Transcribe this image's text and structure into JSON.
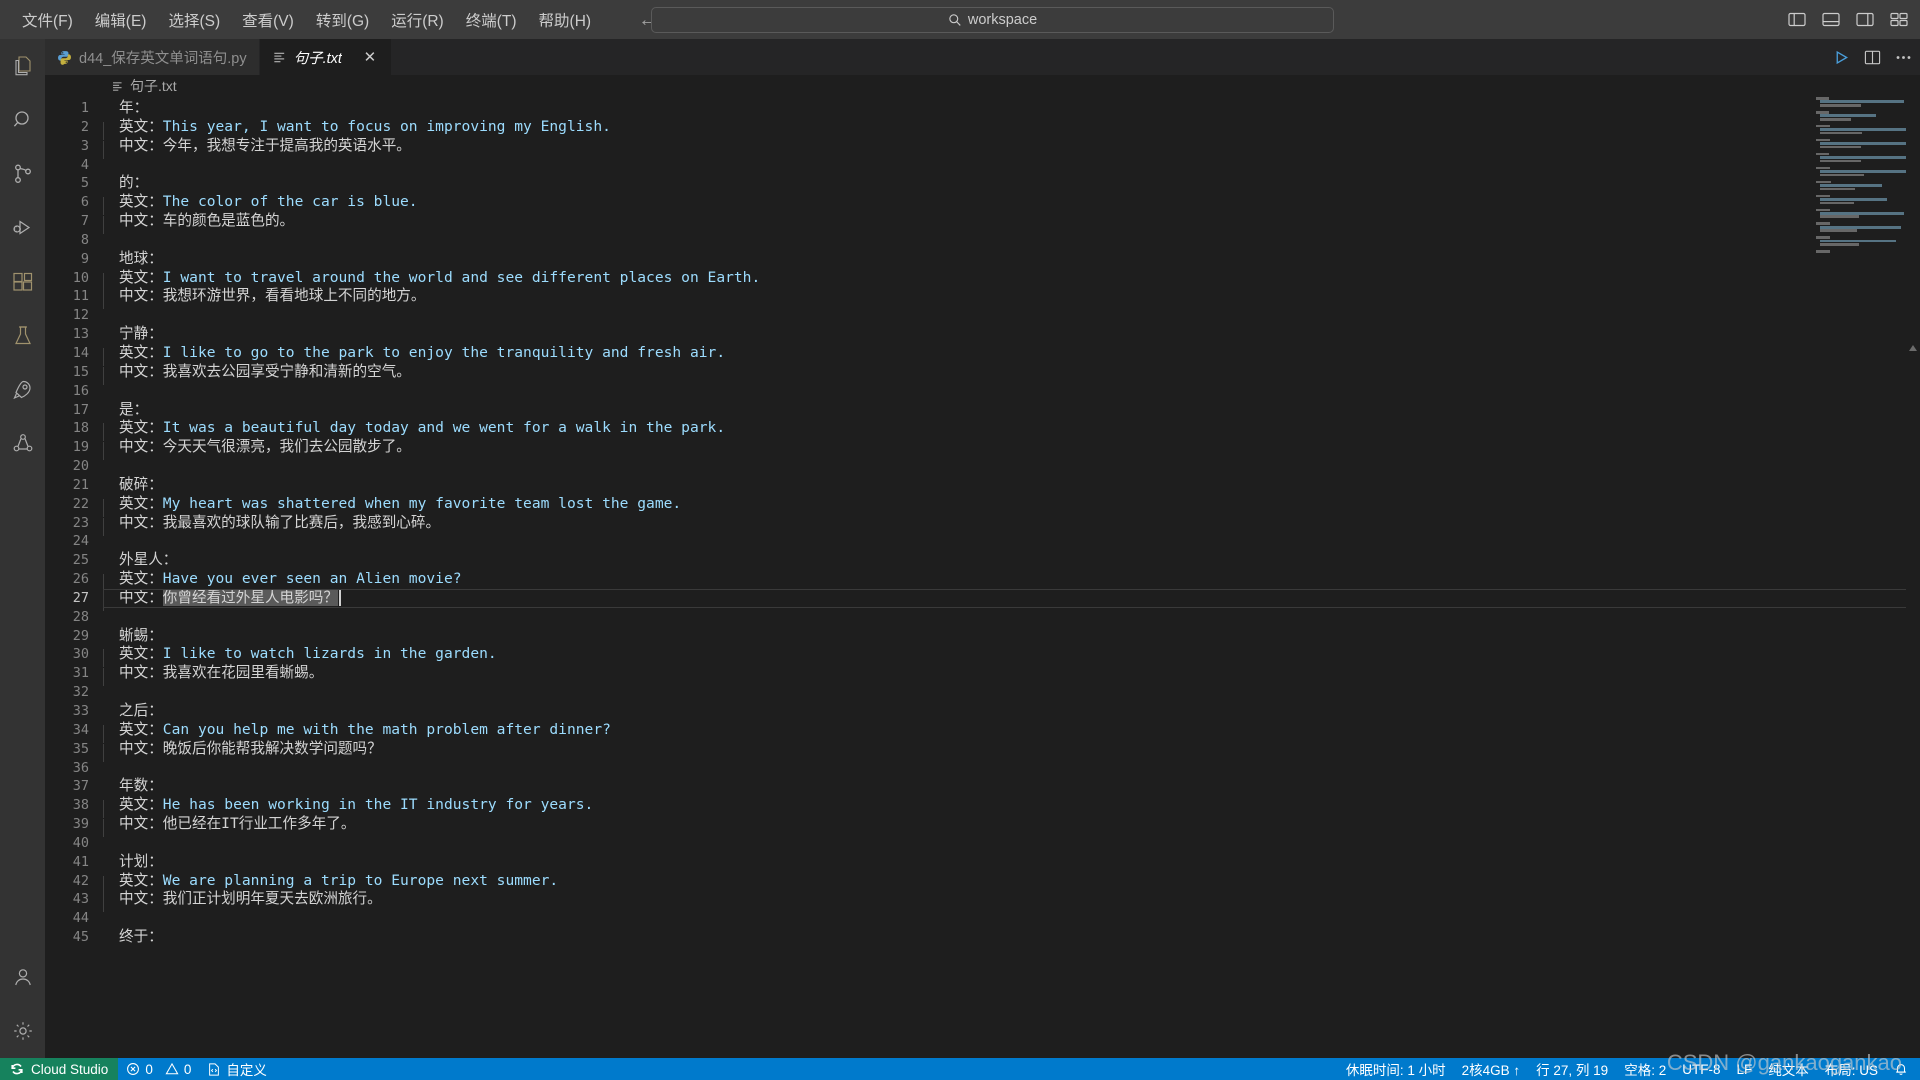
{
  "titlebar": {
    "menus": [
      "文件(F)",
      "编辑(E)",
      "选择(S)",
      "查看(V)",
      "转到(G)",
      "运行(R)",
      "终端(T)",
      "帮助(H)"
    ],
    "back_arrow": "←",
    "forward_arrow": "→",
    "search_value": "workspace",
    "icons": {
      "search": "search-icon",
      "panel_left": "toggle-primary-sidebar-icon",
      "panel_bottom": "toggle-panel-icon",
      "panel_right": "toggle-secondary-sidebar-icon",
      "layout": "customize-layout-icon"
    }
  },
  "activitybar": {
    "items": [
      {
        "name": "explorer",
        "icon": "files-icon"
      },
      {
        "name": "search",
        "icon": "search-icon"
      },
      {
        "name": "source-control",
        "icon": "source-control-icon"
      },
      {
        "name": "run-and-debug",
        "icon": "run-debug-icon"
      },
      {
        "name": "extensions",
        "icon": "extensions-icon"
      },
      {
        "name": "testing",
        "icon": "beaker-icon"
      },
      {
        "name": "remote-explorer",
        "icon": "rocket-icon"
      },
      {
        "name": "collaboration",
        "icon": "collaboration-icon"
      }
    ],
    "bottom": [
      {
        "name": "accounts",
        "icon": "account-icon"
      },
      {
        "name": "settings",
        "icon": "gear-icon"
      }
    ]
  },
  "tabs": [
    {
      "label": "d44_保存英文单词语句.py",
      "icon": "python-icon",
      "active": false,
      "italic": false
    },
    {
      "label": "句子.txt",
      "icon": "text-file-icon",
      "active": true,
      "italic": true,
      "close": "✕"
    }
  ],
  "tab_actions": {
    "run": "run-file-icon",
    "split": "split-editor-icon",
    "more": "more-actions-icon"
  },
  "breadcrumb": {
    "icon": "text-file-icon",
    "label": "句子.txt"
  },
  "editor": {
    "cursor_line": 27,
    "selection_text": "你曾经看过外星人电影吗？",
    "lines": [
      {
        "n": 1,
        "indent": 0,
        "key": "年："
      },
      {
        "n": 2,
        "indent": 1,
        "key": "英文：",
        "en": "This year, I want to focus on improving my English."
      },
      {
        "n": 3,
        "indent": 1,
        "key": "中文：",
        "zh": "今年，我想专注于提高我的英语水平。"
      },
      {
        "n": 4,
        "indent": 0
      },
      {
        "n": 5,
        "indent": 0,
        "key": "的："
      },
      {
        "n": 6,
        "indent": 1,
        "key": "英文：",
        "en": "The color of the car is blue."
      },
      {
        "n": 7,
        "indent": 1,
        "key": "中文：",
        "zh": "车的颜色是蓝色的。"
      },
      {
        "n": 8,
        "indent": 0
      },
      {
        "n": 9,
        "indent": 0,
        "key": "地球："
      },
      {
        "n": 10,
        "indent": 1,
        "key": "英文：",
        "en": "I want to travel around the world and see different places on Earth."
      },
      {
        "n": 11,
        "indent": 1,
        "key": "中文：",
        "zh": "我想环游世界，看看地球上不同的地方。"
      },
      {
        "n": 12,
        "indent": 0
      },
      {
        "n": 13,
        "indent": 0,
        "key": "宁静："
      },
      {
        "n": 14,
        "indent": 1,
        "key": "英文：",
        "en": "I like to go to the park to enjoy the tranquility and fresh air."
      },
      {
        "n": 15,
        "indent": 1,
        "key": "中文：",
        "zh": "我喜欢去公园享受宁静和清新的空气。"
      },
      {
        "n": 16,
        "indent": 0
      },
      {
        "n": 17,
        "indent": 0,
        "key": "是："
      },
      {
        "n": 18,
        "indent": 1,
        "key": "英文：",
        "en": "It was a beautiful day today and we went for a walk in the park."
      },
      {
        "n": 19,
        "indent": 1,
        "key": "中文：",
        "zh": "今天天气很漂亮，我们去公园散步了。"
      },
      {
        "n": 20,
        "indent": 0
      },
      {
        "n": 21,
        "indent": 0,
        "key": "破碎："
      },
      {
        "n": 22,
        "indent": 1,
        "key": "英文：",
        "en": "My heart was shattered when my favorite team lost the game."
      },
      {
        "n": 23,
        "indent": 1,
        "key": "中文：",
        "zh": "我最喜欢的球队输了比赛后，我感到心碎。"
      },
      {
        "n": 24,
        "indent": 0
      },
      {
        "n": 25,
        "indent": 0,
        "key": "外星人："
      },
      {
        "n": 26,
        "indent": 1,
        "key": "英文：",
        "en": "Have you ever seen an Alien movie?"
      },
      {
        "n": 27,
        "indent": 1,
        "key": "中文：",
        "zh": "你曾经看过外星人电影吗？",
        "selected": true,
        "caret": true
      },
      {
        "n": 28,
        "indent": 0
      },
      {
        "n": 29,
        "indent": 0,
        "key": "蜥蜴："
      },
      {
        "n": 30,
        "indent": 1,
        "key": "英文：",
        "en": "I like to watch lizards in the garden."
      },
      {
        "n": 31,
        "indent": 1,
        "key": "中文：",
        "zh": "我喜欢在花园里看蜥蜴。"
      },
      {
        "n": 32,
        "indent": 0
      },
      {
        "n": 33,
        "indent": 0,
        "key": "之后："
      },
      {
        "n": 34,
        "indent": 1,
        "key": "英文：",
        "en": "Can you help me with the math problem after dinner?"
      },
      {
        "n": 35,
        "indent": 1,
        "key": "中文：",
        "zh": "晚饭后你能帮我解决数学问题吗？"
      },
      {
        "n": 36,
        "indent": 0
      },
      {
        "n": 37,
        "indent": 0,
        "key": "年数："
      },
      {
        "n": 38,
        "indent": 1,
        "key": "英文：",
        "en": "He has been working in the IT industry for years."
      },
      {
        "n": 39,
        "indent": 1,
        "key": "中文：",
        "zh": "他已经在IT行业工作多年了。"
      },
      {
        "n": 40,
        "indent": 0
      },
      {
        "n": 41,
        "indent": 0,
        "key": "计划："
      },
      {
        "n": 42,
        "indent": 1,
        "key": "英文：",
        "en": "We are planning a trip to Europe next summer."
      },
      {
        "n": 43,
        "indent": 1,
        "key": "中文：",
        "zh": "我们正计划明年夏天去欧洲旅行。"
      },
      {
        "n": 44,
        "indent": 0
      },
      {
        "n": 45,
        "indent": 0,
        "key": "终于："
      }
    ]
  },
  "statusbar": {
    "brand": "Cloud Studio",
    "errors": "0",
    "warnings": "0",
    "custom": "自定义",
    "sleep_time": "休眠时间: 1 小时",
    "spec": "2核4GB ↑",
    "position": "行 27, 列 19",
    "spaces": "空格: 2",
    "encoding": "UTF-8",
    "eol": "LF",
    "language": "纯文本",
    "keyboard": "布局: US",
    "bell": "bell-icon"
  },
  "watermark": "CSDN @gankaogankao",
  "colors": {
    "accent": "#007acc",
    "brand_green": "#16825d",
    "editor_bg": "#1e1e1e",
    "titlebar_bg": "#3c3c3c",
    "activitybar_bg": "#333333",
    "tabbar_bg": "#252526",
    "string_blue": "#9cdcfe",
    "text": "#d4d4d4"
  }
}
